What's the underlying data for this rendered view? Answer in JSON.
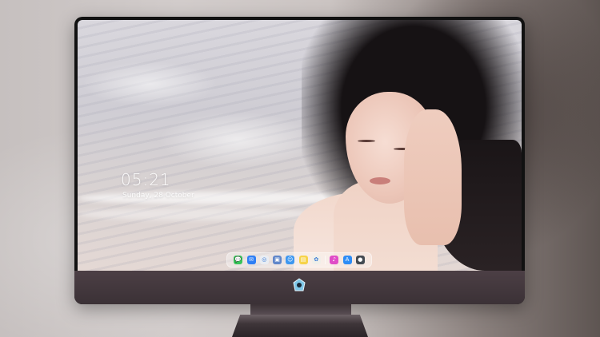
{
  "lock_screen": {
    "time": "05:21",
    "date": "Sunday, 28 October"
  },
  "dock": {
    "items": [
      {
        "name": "messages",
        "glyph": "💬",
        "color": "#39c45a"
      },
      {
        "name": "mail",
        "glyph": "✉",
        "color": "#2f7ff5"
      },
      {
        "name": "safari",
        "glyph": "◎",
        "color": "#e9edf3"
      },
      {
        "name": "preview",
        "glyph": "▣",
        "color": "#5f86c9"
      },
      {
        "name": "finder",
        "glyph": "☺",
        "color": "#3d97f0"
      },
      {
        "name": "notes",
        "glyph": "▤",
        "color": "#f6d34a"
      },
      {
        "name": "photos",
        "glyph": "✿",
        "color": "#f0efe9"
      },
      {
        "name": "itunes",
        "glyph": "♪",
        "color": "#e04cc7"
      },
      {
        "name": "app-store",
        "glyph": "A",
        "color": "#2d8cf6"
      },
      {
        "name": "camera",
        "glyph": "●",
        "color": "#444b52"
      }
    ]
  },
  "colors": {
    "monitor_chin": "#4c3f45",
    "bezel": "#111111"
  }
}
